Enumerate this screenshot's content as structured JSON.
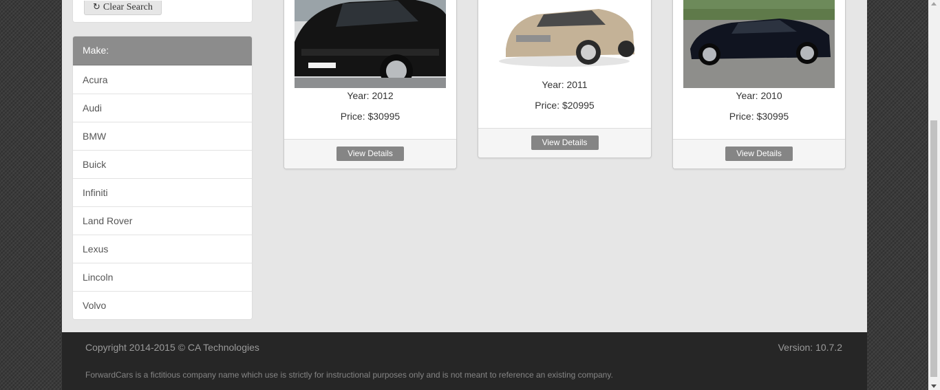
{
  "sidebar": {
    "clear_search_label": "Clear Search",
    "make_heading": "Make:",
    "makes": [
      "Acura",
      "Audi",
      "BMW",
      "Buick",
      "Infiniti",
      "Land Rover",
      "Lexus",
      "Lincoln",
      "Volvo"
    ]
  },
  "cars": [
    {
      "year": "Year: 2012",
      "price": "Price: $30995",
      "button": "View Details",
      "body_color": "#151515"
    },
    {
      "year": "Year: 2011",
      "price": "Price: $20995",
      "button": "View Details",
      "body_color": "#b8a68c"
    },
    {
      "year": "Year: 2010",
      "price": "Price: $30995",
      "button": "View Details",
      "body_color": "#101420"
    }
  ],
  "footer": {
    "copyright": "Copyright 2014-2015 © CA Technologies",
    "version": "Version: 10.7.2",
    "disclaimer": "ForwardCars is a fictitious company name which use is strictly for instructional purposes only and is not meant to reference an existing company."
  }
}
